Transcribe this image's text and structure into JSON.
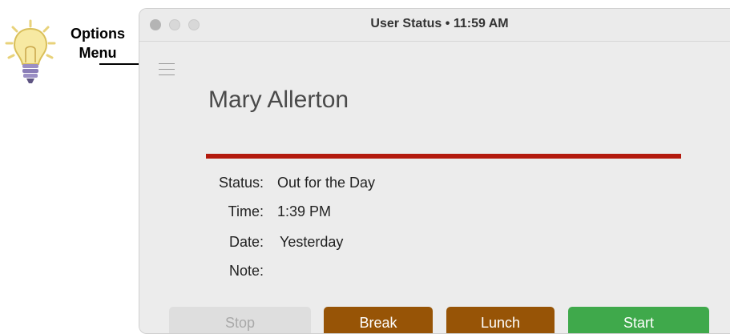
{
  "callout": {
    "line1": "Options",
    "line2": "Menu"
  },
  "window": {
    "title": "User Status • 11:59 AM"
  },
  "user": {
    "name": "Mary Allerton"
  },
  "fields": {
    "status_label": "Status:",
    "status_value": "Out for the Day",
    "time_label": "Time:",
    "time_value": "1:39 PM",
    "date_label": "Date:",
    "date_value": "Yesterday",
    "note_label": "Note:",
    "note_value": ""
  },
  "buttons": {
    "stop": "Stop",
    "break": "Break",
    "lunch": "Lunch",
    "start": "Start"
  },
  "colors": {
    "name_rule": "#b31a0d",
    "break": "#975406",
    "lunch": "#975406",
    "start": "#3fa94b",
    "stop_disabled": "#dedede"
  },
  "icons": {
    "tip": "lightbulb-icon",
    "menu": "hamburger-menu-icon",
    "pointer": "arrow-right-icon"
  }
}
